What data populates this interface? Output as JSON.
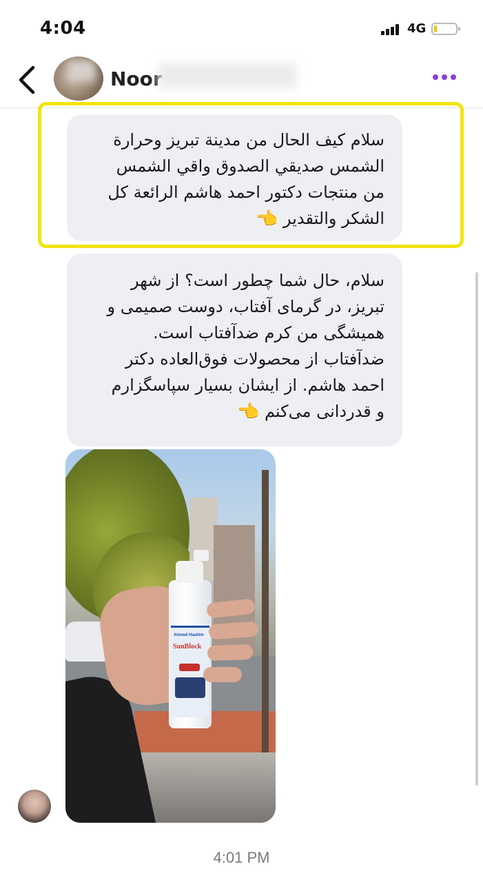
{
  "status_bar": {
    "time": "4:04",
    "network": "4G"
  },
  "header": {
    "contact_name": "Noor"
  },
  "messages": [
    {
      "text": "سلام كيف الحال من مدينة تبريز وحرارة\nالشمس صديقي الصدوق واقي الشمس\nمن منتجات دكتور احمد هاشم الرائعة كل\nالشكر والتقدير",
      "emoji": "👈"
    },
    {
      "text": "سلام، حال شما چطور است؟ از شهر\nتبريز، در گرمای آفتاب، دوست صمیمی و\nهمیشگی من کرم ضدآفتاب است.\nضدآفتاب از محصولات فوق‌العاده دکتر\nاحمد هاشم. از ایشان بسیار سپاسگزارم\nو قدردانی می‌کنم",
      "emoji": "👈"
    }
  ],
  "photo": {
    "product_brand": "Ahmed Hashim",
    "product_name": "SunBlock"
  },
  "timestamp": "4:01 PM"
}
